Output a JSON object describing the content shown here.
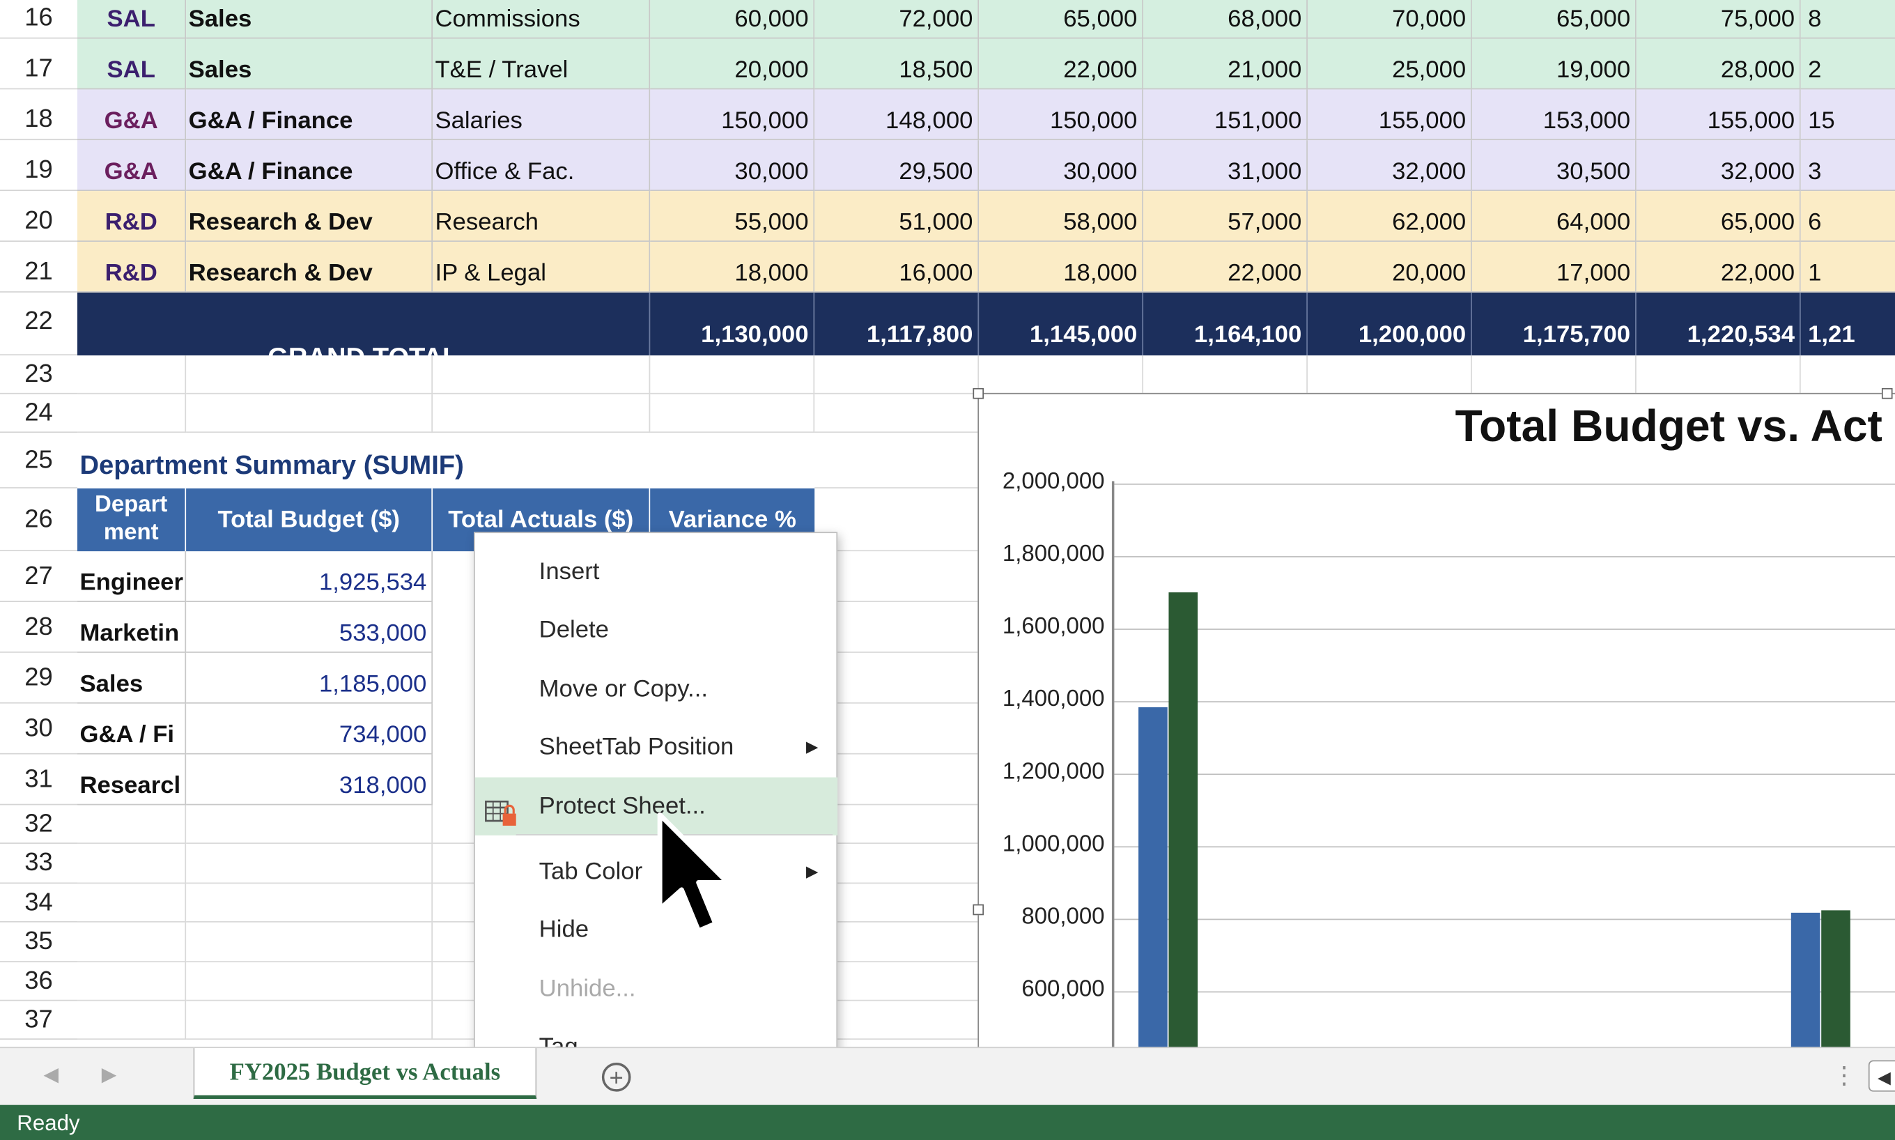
{
  "rows": [
    {
      "num": "16",
      "code": "SAL",
      "dept": "Sales",
      "item": "Commissions",
      "vals": [
        "60,000",
        "72,000",
        "65,000",
        "68,000",
        "70,000",
        "65,000",
        "75,000",
        "8"
      ],
      "bg": "#d5efe0",
      "codeColor": "#3b1f6e"
    },
    {
      "num": "17",
      "code": "SAL",
      "dept": "Sales",
      "item": "T&E / Travel",
      "vals": [
        "20,000",
        "18,500",
        "22,000",
        "21,000",
        "25,000",
        "19,000",
        "28,000",
        "2"
      ],
      "bg": "#d5efe0",
      "codeColor": "#3b1f6e"
    },
    {
      "num": "18",
      "code": "G&A",
      "dept": "G&A / Finance",
      "item": "Salaries",
      "vals": [
        "150,000",
        "148,000",
        "150,000",
        "151,000",
        "155,000",
        "153,000",
        "155,000",
        "15"
      ],
      "bg": "#e6e3f7",
      "codeColor": "#6b1f5e"
    },
    {
      "num": "19",
      "code": "G&A",
      "dept": "G&A / Finance",
      "item": "Office & Fac.",
      "vals": [
        "30,000",
        "29,500",
        "30,000",
        "31,000",
        "32,000",
        "30,500",
        "32,000",
        "3"
      ],
      "bg": "#e6e3f7",
      "codeColor": "#6b1f5e"
    },
    {
      "num": "20",
      "code": "R&D",
      "dept": "Research & Dev",
      "item": "Research",
      "vals": [
        "55,000",
        "51,000",
        "58,000",
        "57,000",
        "62,000",
        "64,000",
        "65,000",
        "6"
      ],
      "bg": "#fbecc6",
      "codeColor": "#3b1f6e"
    },
    {
      "num": "21",
      "code": "R&D",
      "dept": "Research & Dev",
      "item": "IP & Legal",
      "vals": [
        "18,000",
        "16,000",
        "18,000",
        "22,000",
        "20,000",
        "17,000",
        "22,000",
        "1"
      ],
      "bg": "#fbecc6",
      "codeColor": "#3b1f6e"
    }
  ],
  "grand_total": {
    "num": "22",
    "label": "GRAND TOTAL",
    "vals": [
      "1,130,000",
      "1,117,800",
      "1,145,000",
      "1,164,100",
      "1,200,000",
      "1,175,700",
      "1,220,534",
      "1,21"
    ]
  },
  "empty_rows": [
    "23",
    "24"
  ],
  "summary": {
    "title_row": "25",
    "title": "Department Summary (SUMIF)",
    "header_row": "26",
    "headers": [
      "Depart ment",
      "Total Budget ($)",
      "Total Actuals ($)",
      "Variance %"
    ],
    "rows": [
      {
        "num": "27",
        "dept": "Engineer",
        "budget": "1,925,534"
      },
      {
        "num": "28",
        "dept": "Marketin",
        "budget": "533,000"
      },
      {
        "num": "29",
        "dept": "Sales",
        "budget": "1,185,000"
      },
      {
        "num": "30",
        "dept": "G&A / Fi",
        "budget": "734,000"
      },
      {
        "num": "31",
        "dept": "Researcl",
        "budget": "318,000"
      }
    ],
    "trailing_rows": [
      "32",
      "33",
      "34",
      "35",
      "36",
      "37"
    ]
  },
  "chart_data": {
    "type": "bar",
    "title": "Total Budget vs. Act",
    "yticks": [
      "2,000,000",
      "1,800,000",
      "1,600,000",
      "1,400,000",
      "1,200,000",
      "1,000,000",
      "800,000",
      "600,000"
    ],
    "ylim": [
      600000,
      2000000
    ],
    "series": [
      {
        "color": "#3a68a8",
        "values": [
          1385000,
          818000
        ]
      },
      {
        "color": "#2b5a33",
        "values": [
          1700000,
          822000
        ]
      }
    ]
  },
  "context_menu": {
    "items": [
      {
        "label": "Insert",
        "name": "menu-insert",
        "submenu": false,
        "disabled": false
      },
      {
        "label": "Delete",
        "name": "menu-delete",
        "submenu": false,
        "disabled": false
      },
      {
        "label": "Move or Copy...",
        "name": "menu-move-copy",
        "submenu": false,
        "disabled": false
      },
      {
        "label": "SheetTab Position",
        "name": "menu-sheettab-position",
        "submenu": true,
        "disabled": false
      },
      {
        "label": "Protect Sheet...",
        "name": "menu-protect-sheet",
        "submenu": false,
        "disabled": false,
        "highlight": true
      },
      {
        "label": "Tab Color",
        "name": "menu-tab-color",
        "submenu": true,
        "disabled": false
      },
      {
        "label": "Hide",
        "name": "menu-hide",
        "submenu": false,
        "disabled": false
      },
      {
        "label": "Unhide...",
        "name": "menu-unhide",
        "submenu": false,
        "disabled": true
      },
      {
        "label": "Tag...",
        "name": "menu-tag",
        "submenu": false,
        "disabled": false
      }
    ]
  },
  "tabs": {
    "active": "FY2025 Budget vs Actuals"
  },
  "status": {
    "text": "Ready"
  },
  "colors": {
    "navy": "#1c2f5c",
    "header_blue": "#3a68a8",
    "status_green": "#2e6b44",
    "tab_green": "#2e6b44"
  }
}
